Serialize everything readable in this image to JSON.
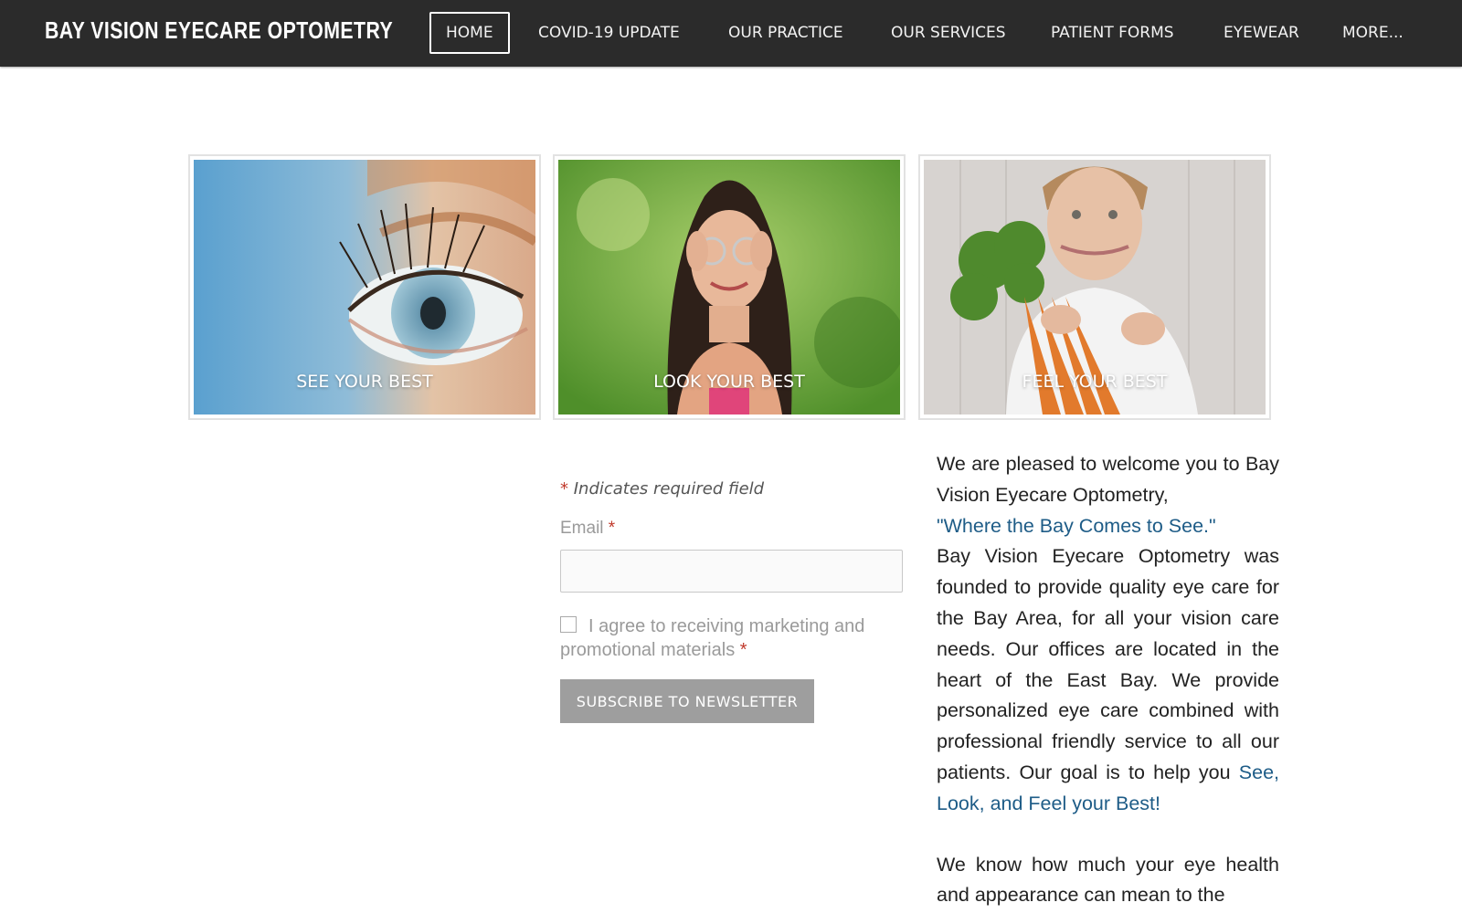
{
  "header": {
    "brand": "BAY VISION EYECARE OPTOMETRY",
    "nav": [
      {
        "label": "HOME",
        "active": true
      },
      {
        "label": "COVID-19 UPDATE"
      },
      {
        "label": "OUR PRACTICE"
      },
      {
        "label": "OUR SERVICES"
      },
      {
        "label": "PATIENT FORMS"
      },
      {
        "label": "EYEWEAR"
      },
      {
        "label": "MORE..."
      }
    ]
  },
  "tiles": [
    {
      "caption": "SEE YOUR BEST"
    },
    {
      "caption": "LOOK YOUR BEST"
    },
    {
      "caption": "FEEL YOUR BEST"
    }
  ],
  "newsletter": {
    "required_star": "*",
    "required_note": "Indicates required field",
    "email_label": "Email",
    "email_value": "",
    "agree_text": "I agree to receiving marketing and promotional materials",
    "subscribe_label": "SUBSCRIBE TO NEWSLETTER"
  },
  "welcome": {
    "intro": "We are pleased to welcome you to Bay Vision Eyecare Optometry,",
    "tagline": "\"Where the Bay Comes to See.\"",
    "body": "Bay Vision Eyecare Optometry was founded to provide quality eye care for the Bay Area, for all your vision care needs. Our offices are located in the heart of the East Bay. We provide personalized eye care combined with professional friendly service to all our patients. Our goal is to help you",
    "goal_highlight": "See, Look, and Feel your Best!",
    "second_paragraph": "We know how much your eye health and appearance can mean to the"
  },
  "colors": {
    "header_bg": "#2b2b2b",
    "link_blue": "#1e5c87",
    "required_red": "#c0392b",
    "button_gray": "#9e9e9e"
  }
}
